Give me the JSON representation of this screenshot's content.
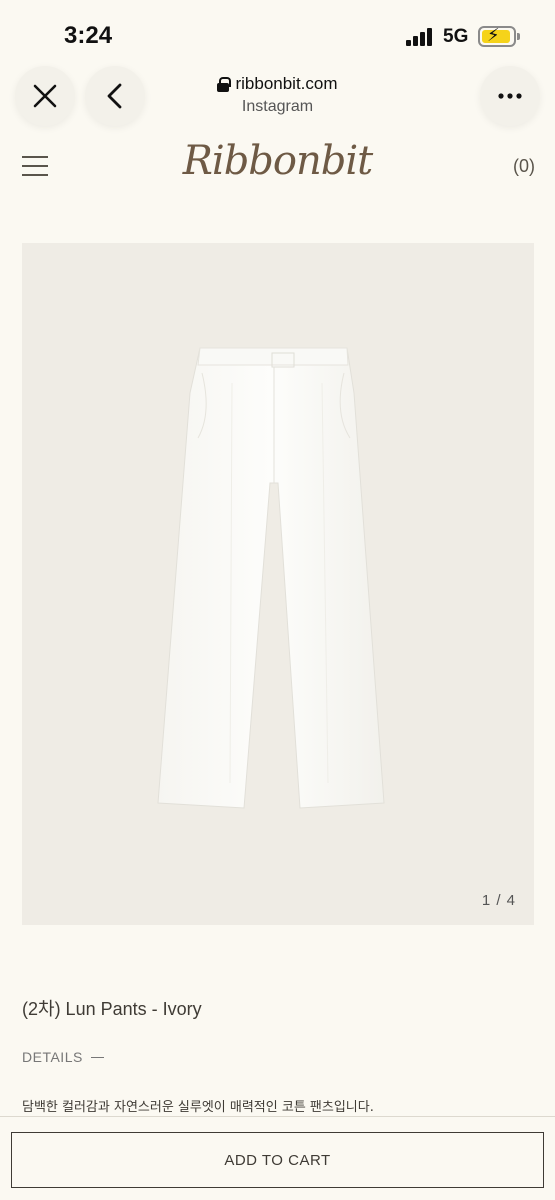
{
  "status_bar": {
    "time": "3:24",
    "network": "5G",
    "battery_color": "#f5d31a"
  },
  "browser": {
    "domain": "ribbonbit.com",
    "source": "Instagram",
    "close_icon": "close-icon",
    "back_icon": "chevron-left-icon",
    "more_icon": "more-horizontal-icon"
  },
  "site": {
    "logo": "Ribbonbit",
    "cart_count": "(0)",
    "brand_color": "#6e5a45",
    "background": "#fbf9f2"
  },
  "product": {
    "slide_counter": "1 / 4",
    "title": "(2차) Lun Pants - Ivory",
    "details_label": "DETAILS",
    "description": "담백한 컬러감과 자연스러운 실루엣이 매력적인 코튼 팬츠입니다."
  },
  "cart": {
    "button_label": "ADD TO CART"
  }
}
